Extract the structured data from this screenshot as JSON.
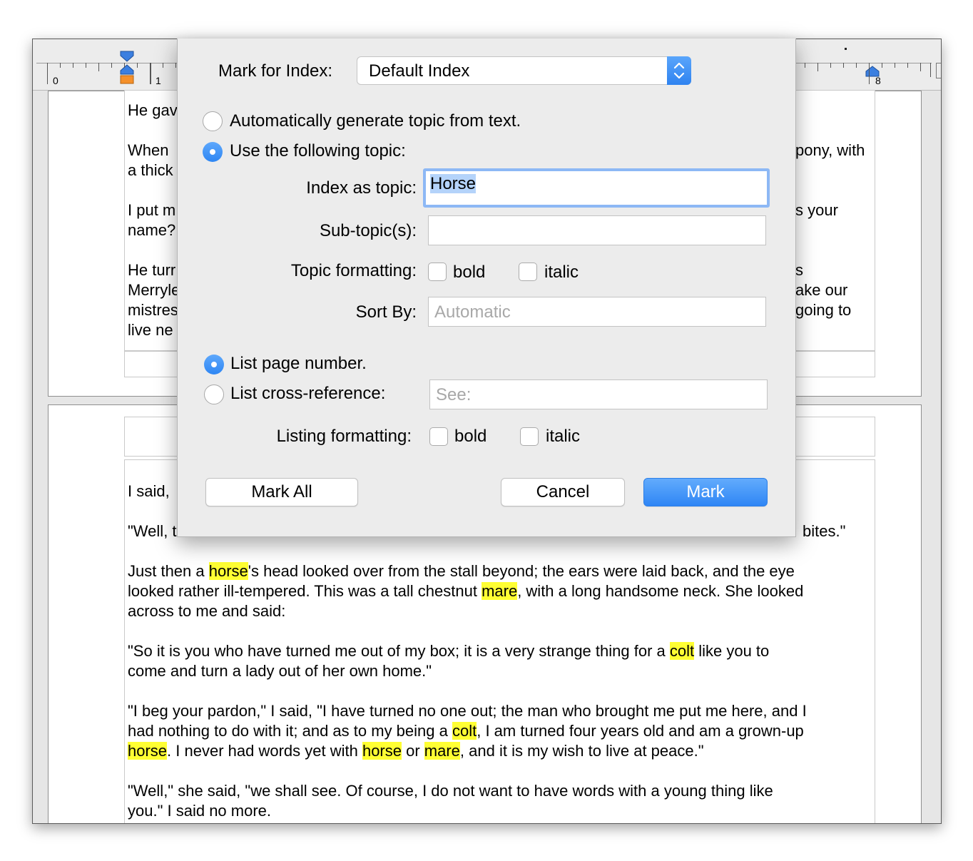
{
  "ruler": {
    "num_0": "0",
    "num_1": "1",
    "num_8": "8"
  },
  "document": {
    "page1": [
      {
        "left": "He gav",
        "right": ""
      },
      {
        "left": "When",
        "right": "pony, with"
      },
      {
        "left": "a thick",
        "right": ""
      },
      {
        "left": "I put m",
        "right": "s your"
      },
      {
        "left": "name?",
        "right": ""
      },
      {
        "left": "He turr",
        "right": "s"
      },
      {
        "left": "Merryle",
        "right": "ake our"
      },
      {
        "left": "mistres",
        "right": "going to"
      },
      {
        "left": "live ne",
        "right": ""
      }
    ],
    "page2_first_left": "I said,",
    "page2_partial_left": "\"Well, t",
    "page2_partial_right": "bites.\"",
    "para1": {
      "l1a": "Just then a ",
      "l1b": "horse",
      "l1c": "'s head looked over from the stall beyond; the ears were laid back, and the eye",
      "l2a": "looked rather ill-tempered. This was a tall chestnut ",
      "l2b": "mare",
      "l2c": ", with a long handsome neck. She looked",
      "l3": "across to me and said:"
    },
    "para2": {
      "l1a": "\"So it is you who have turned me out of my box; it is a very strange thing for a ",
      "l1b": "colt",
      "l1c": " like you to",
      "l2": "come and turn a lady out of her own home.\""
    },
    "para3": {
      "l1": "\"I beg your pardon,\" I said, \"I have turned no one out; the man who brought me put me here, and I",
      "l2a": "had nothing to do with it; and as to my being a ",
      "l2b": "colt",
      "l2c": ", I am turned four years old and am a grown-up",
      "l3a": "horse",
      "l3b": ". I never had words yet with ",
      "l3c": "horse",
      "l3d": " or ",
      "l3e": "mare",
      "l3f": ", and it is my wish to live at peace.\""
    },
    "para4": {
      "l1": "\"Well,\" she said, \"we shall see. Of course, I do not want to have words with a young thing like",
      "l2": "you.\" I said no more."
    }
  },
  "dialog": {
    "mark_for_index_label": "Mark for Index:",
    "index_select_value": "Default Index",
    "radio_auto_label": "Automatically generate topic from text.",
    "radio_use_label": "Use the following topic:",
    "index_as_topic_label": "Index as topic:",
    "index_as_topic_value": "Horse",
    "subtopic_label": "Sub-topic(s):",
    "subtopic_value": "",
    "topic_formatting_label": "Topic formatting:",
    "bold_label": "bold",
    "italic_label": "italic",
    "sort_by_label": "Sort By:",
    "sort_by_placeholder": "Automatic",
    "radio_page_label": "List page number.",
    "radio_xref_label": "List cross-reference:",
    "xref_placeholder": "See:",
    "listing_formatting_label": "Listing formatting:",
    "mark_all_button": "Mark All",
    "cancel_button": "Cancel",
    "mark_button": "Mark"
  },
  "colors": {
    "accent": "#2f86f5",
    "highlight": "#ffff33",
    "focus_ring": "#8db8f5"
  }
}
